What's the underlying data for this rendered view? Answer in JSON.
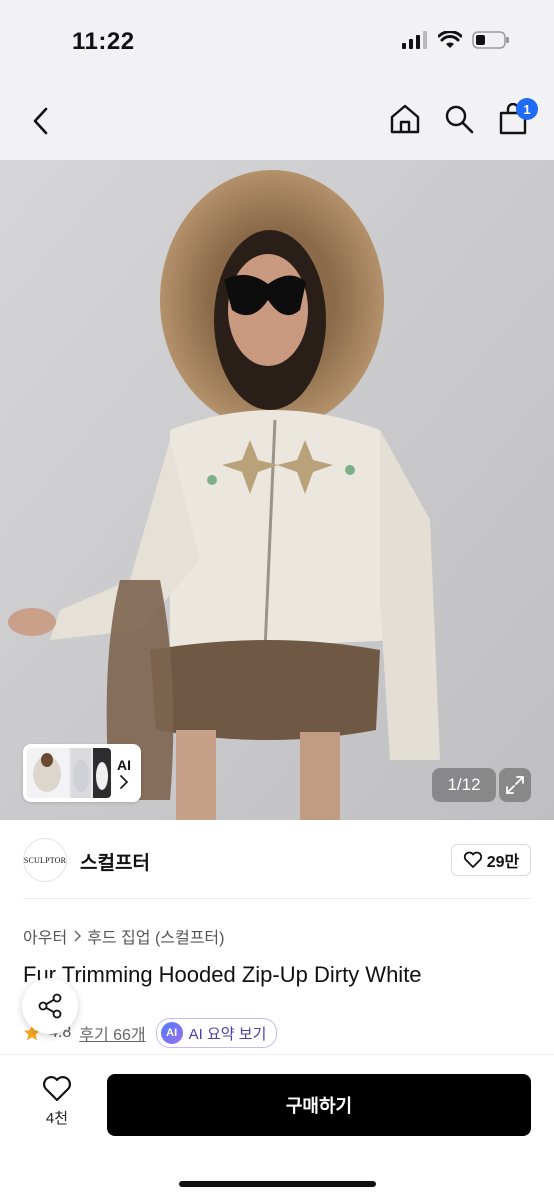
{
  "status_bar": {
    "time": "11:22"
  },
  "nav": {
    "cart_count": "1"
  },
  "gallery": {
    "counter": "1/12",
    "ai_thumb_label": "AI"
  },
  "brand": {
    "logo_text": "SCULPTOR",
    "name": "스컬프터",
    "likes": "29만"
  },
  "product": {
    "breadcrumb": [
      "아우터",
      "후드 집업 (스컬프터)"
    ],
    "title": "Fur Trimming Hooded Zip-Up Dirty White",
    "rating": "4.8",
    "reviews": "후기 66개",
    "ai_summary_badge": "AI",
    "ai_summary_label": "AI 요약 보기"
  },
  "bottom": {
    "wish_count": "4천",
    "buy_label": "구매하기"
  },
  "colors": {
    "accent_blue": "#1f6bf5",
    "buy_button": "#000000",
    "rating_star": "#f5a623"
  }
}
